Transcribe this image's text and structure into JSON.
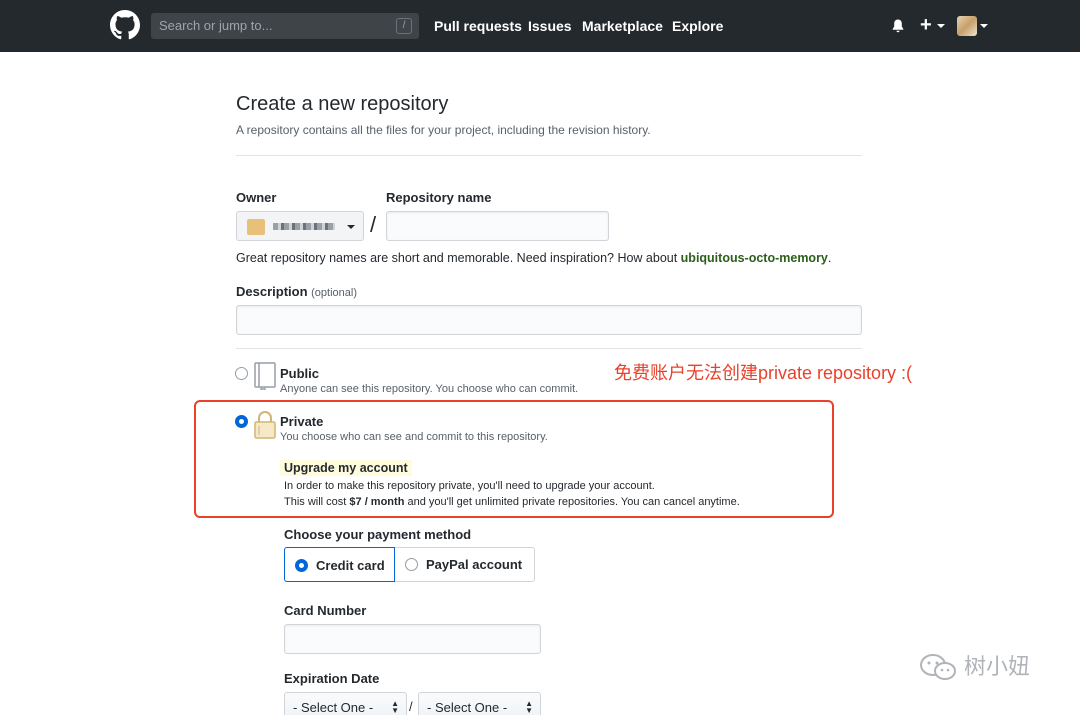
{
  "header": {
    "search_placeholder": "Search or jump to...",
    "search_shortcut": "/",
    "nav": [
      "Pull requests",
      "Issues",
      "Marketplace",
      "Explore"
    ],
    "plus_label": "+"
  },
  "page": {
    "title": "Create a new repository",
    "subtitle": "A repository contains all the files for your project, including the revision history."
  },
  "form": {
    "owner_label": "Owner",
    "repo_label": "Repository name",
    "slash": "/",
    "hint_prefix": "Great repository names are short and memorable. Need inspiration? How about ",
    "hint_suggestion": "ubiquitous-octo-memory",
    "hint_suffix": ".",
    "description_label": "Description",
    "description_optional": "(optional)",
    "public_title": "Public",
    "public_desc": "Anyone can see this repository. You choose who can commit.",
    "private_title": "Private",
    "private_desc": "You choose who can see and commit to this repository.",
    "upgrade_title": "Upgrade my account",
    "upgrade_line1": "In order to make this repository private, you'll need to upgrade your account.",
    "upgrade_line2_prefix": "This will cost ",
    "upgrade_price": "$7 / month",
    "upgrade_line2_suffix": " and you'll get unlimited private repositories. You can cancel anytime.",
    "payment_label": "Choose your payment method",
    "payment_options": [
      "Credit card",
      "PayPal account"
    ],
    "payment_selected": "Credit card",
    "card_number_label": "Card Number",
    "expiration_label": "Expiration Date",
    "select_month": "- Select One -",
    "select_year": "- Select One -",
    "date_sep": "/"
  },
  "annotation": "免费账户无法创建private repository :(",
  "watermark": "树小妞",
  "colors": {
    "header_bg": "#24292e",
    "accent": "#0366d6",
    "annotation_red": "#e8412c",
    "suggestion_green": "#2c5e1a"
  }
}
